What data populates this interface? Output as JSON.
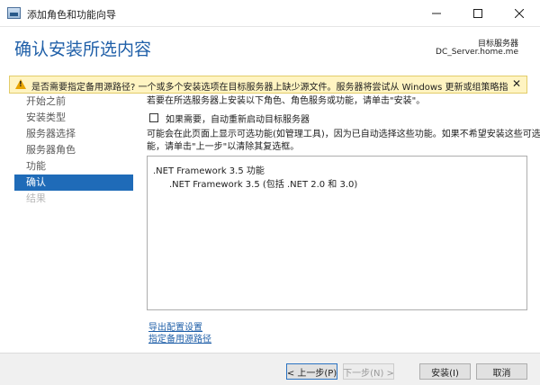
{
  "window": {
    "title": "添加角色和功能向导",
    "min_icon": "minimize-icon",
    "max_icon": "maximize-icon",
    "close_icon": "close-icon"
  },
  "header": {
    "page_title": "确认安装所选内容",
    "destination_label": "目标服务器",
    "destination_server": "DC_Server.home.me"
  },
  "warning": {
    "icon": "warning-icon",
    "text": "是否需要指定备用源路径? 一个或多个安装选项在目标服务器上缺少源文件。服务器将尝试从 Windows 更新或组策略指定的...",
    "close_label": "✕",
    "color": "#fff4c2"
  },
  "nav": {
    "items": [
      {
        "label": "开始之前"
      },
      {
        "label": "安装类型"
      },
      {
        "label": "服务器选择"
      },
      {
        "label": "服务器角色"
      },
      {
        "label": "功能"
      },
      {
        "label": "确认"
      },
      {
        "label": "结果"
      }
    ],
    "active_index": 5,
    "active_color": "#1f6bb8"
  },
  "main": {
    "intro": "若要在所选服务器上安装以下角色、角色服务或功能，请单击\"安装\"。",
    "restart_label": "如果需要，自动重新启动目标服务器",
    "restart_checked": false,
    "note_line1": "可能会在此页面上显示可选功能(如管理工具)，因为已自动选择这些功能。如果不希望安装这些可选功",
    "note_line2": "能，请单击\"上一步\"以清除其复选框。",
    "features": {
      "parent": ".NET Framework 3.5 功能",
      "child": ".NET Framework 3.5 (包括 .NET 2.0 和 3.0)"
    },
    "link_export": "导出配置设置",
    "link_alt_source": "指定备用源路径"
  },
  "footer": {
    "prev_label": "< 上一步(P)",
    "next_label": "下一步(N) >",
    "install_label": "安装(I)",
    "cancel_label": "取消"
  }
}
